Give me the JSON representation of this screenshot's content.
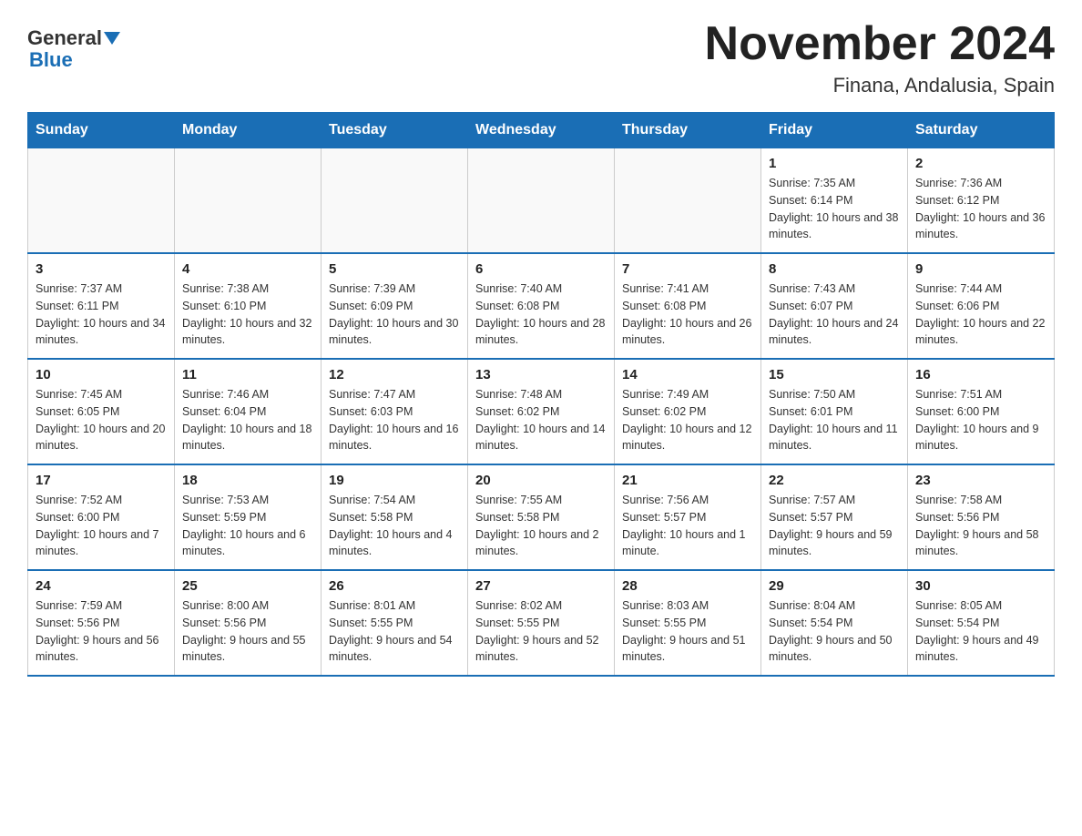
{
  "header": {
    "logo_general": "General",
    "logo_blue": "Blue",
    "month_title": "November 2024",
    "location": "Finana, Andalusia, Spain"
  },
  "weekdays": [
    "Sunday",
    "Monday",
    "Tuesday",
    "Wednesday",
    "Thursday",
    "Friday",
    "Saturday"
  ],
  "weeks": [
    {
      "days": [
        {
          "num": "",
          "info": ""
        },
        {
          "num": "",
          "info": ""
        },
        {
          "num": "",
          "info": ""
        },
        {
          "num": "",
          "info": ""
        },
        {
          "num": "",
          "info": ""
        },
        {
          "num": "1",
          "info": "Sunrise: 7:35 AM\nSunset: 6:14 PM\nDaylight: 10 hours and 38 minutes."
        },
        {
          "num": "2",
          "info": "Sunrise: 7:36 AM\nSunset: 6:12 PM\nDaylight: 10 hours and 36 minutes."
        }
      ]
    },
    {
      "days": [
        {
          "num": "3",
          "info": "Sunrise: 7:37 AM\nSunset: 6:11 PM\nDaylight: 10 hours and 34 minutes."
        },
        {
          "num": "4",
          "info": "Sunrise: 7:38 AM\nSunset: 6:10 PM\nDaylight: 10 hours and 32 minutes."
        },
        {
          "num": "5",
          "info": "Sunrise: 7:39 AM\nSunset: 6:09 PM\nDaylight: 10 hours and 30 minutes."
        },
        {
          "num": "6",
          "info": "Sunrise: 7:40 AM\nSunset: 6:08 PM\nDaylight: 10 hours and 28 minutes."
        },
        {
          "num": "7",
          "info": "Sunrise: 7:41 AM\nSunset: 6:08 PM\nDaylight: 10 hours and 26 minutes."
        },
        {
          "num": "8",
          "info": "Sunrise: 7:43 AM\nSunset: 6:07 PM\nDaylight: 10 hours and 24 minutes."
        },
        {
          "num": "9",
          "info": "Sunrise: 7:44 AM\nSunset: 6:06 PM\nDaylight: 10 hours and 22 minutes."
        }
      ]
    },
    {
      "days": [
        {
          "num": "10",
          "info": "Sunrise: 7:45 AM\nSunset: 6:05 PM\nDaylight: 10 hours and 20 minutes."
        },
        {
          "num": "11",
          "info": "Sunrise: 7:46 AM\nSunset: 6:04 PM\nDaylight: 10 hours and 18 minutes."
        },
        {
          "num": "12",
          "info": "Sunrise: 7:47 AM\nSunset: 6:03 PM\nDaylight: 10 hours and 16 minutes."
        },
        {
          "num": "13",
          "info": "Sunrise: 7:48 AM\nSunset: 6:02 PM\nDaylight: 10 hours and 14 minutes."
        },
        {
          "num": "14",
          "info": "Sunrise: 7:49 AM\nSunset: 6:02 PM\nDaylight: 10 hours and 12 minutes."
        },
        {
          "num": "15",
          "info": "Sunrise: 7:50 AM\nSunset: 6:01 PM\nDaylight: 10 hours and 11 minutes."
        },
        {
          "num": "16",
          "info": "Sunrise: 7:51 AM\nSunset: 6:00 PM\nDaylight: 10 hours and 9 minutes."
        }
      ]
    },
    {
      "days": [
        {
          "num": "17",
          "info": "Sunrise: 7:52 AM\nSunset: 6:00 PM\nDaylight: 10 hours and 7 minutes."
        },
        {
          "num": "18",
          "info": "Sunrise: 7:53 AM\nSunset: 5:59 PM\nDaylight: 10 hours and 6 minutes."
        },
        {
          "num": "19",
          "info": "Sunrise: 7:54 AM\nSunset: 5:58 PM\nDaylight: 10 hours and 4 minutes."
        },
        {
          "num": "20",
          "info": "Sunrise: 7:55 AM\nSunset: 5:58 PM\nDaylight: 10 hours and 2 minutes."
        },
        {
          "num": "21",
          "info": "Sunrise: 7:56 AM\nSunset: 5:57 PM\nDaylight: 10 hours and 1 minute."
        },
        {
          "num": "22",
          "info": "Sunrise: 7:57 AM\nSunset: 5:57 PM\nDaylight: 9 hours and 59 minutes."
        },
        {
          "num": "23",
          "info": "Sunrise: 7:58 AM\nSunset: 5:56 PM\nDaylight: 9 hours and 58 minutes."
        }
      ]
    },
    {
      "days": [
        {
          "num": "24",
          "info": "Sunrise: 7:59 AM\nSunset: 5:56 PM\nDaylight: 9 hours and 56 minutes."
        },
        {
          "num": "25",
          "info": "Sunrise: 8:00 AM\nSunset: 5:56 PM\nDaylight: 9 hours and 55 minutes."
        },
        {
          "num": "26",
          "info": "Sunrise: 8:01 AM\nSunset: 5:55 PM\nDaylight: 9 hours and 54 minutes."
        },
        {
          "num": "27",
          "info": "Sunrise: 8:02 AM\nSunset: 5:55 PM\nDaylight: 9 hours and 52 minutes."
        },
        {
          "num": "28",
          "info": "Sunrise: 8:03 AM\nSunset: 5:55 PM\nDaylight: 9 hours and 51 minutes."
        },
        {
          "num": "29",
          "info": "Sunrise: 8:04 AM\nSunset: 5:54 PM\nDaylight: 9 hours and 50 minutes."
        },
        {
          "num": "30",
          "info": "Sunrise: 8:05 AM\nSunset: 5:54 PM\nDaylight: 9 hours and 49 minutes."
        }
      ]
    }
  ]
}
